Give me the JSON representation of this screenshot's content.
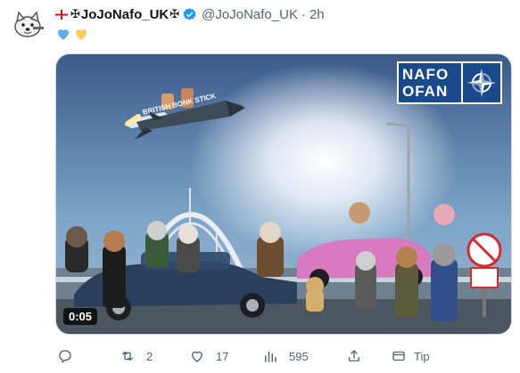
{
  "tweet": {
    "display_name": "JoJoNafo_UK",
    "handle": "@JoJoNafo_UK",
    "separator": "·",
    "time": "2h",
    "text_emojis": [
      "💙",
      "💛"
    ]
  },
  "media": {
    "logo_line1": "NAFO",
    "logo_line2": "OFAN",
    "missile_text": "BRITISH BONK STICK",
    "duration": "0:05"
  },
  "actions": {
    "reply_count": "",
    "retweet_count": "2",
    "like_count": "17",
    "views_count": "595",
    "tip_label": "Tip"
  },
  "colors": {
    "verified": "#1d9bf0",
    "secondary_text": "#536471",
    "nafo_blue": "#1a4a8c"
  },
  "icons": [
    "reply-icon",
    "retweet-icon",
    "like-icon",
    "views-icon",
    "share-icon",
    "tip-icon",
    "verified-badge-icon"
  ]
}
